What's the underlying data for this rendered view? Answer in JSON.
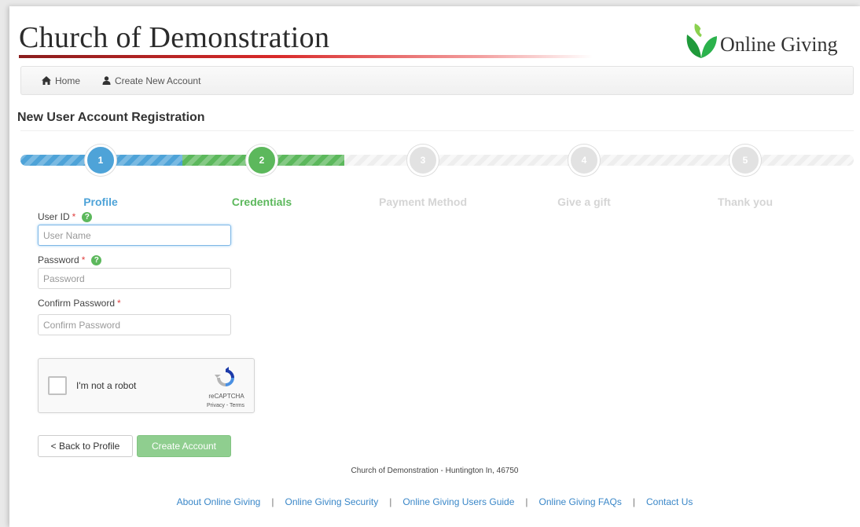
{
  "header": {
    "church_name": "Church of Demonstration",
    "logo_text": "Online Giving",
    "accent_color": "#d92a2a"
  },
  "nav": {
    "items": [
      {
        "label": "Home",
        "icon": "home-icon"
      },
      {
        "label": "Create New Account",
        "icon": "user-icon"
      }
    ]
  },
  "page": {
    "heading": "New User Account Registration"
  },
  "stepper": {
    "steps": [
      {
        "number": "1",
        "label": "Profile",
        "state": "complete",
        "color": "#4ea3d8"
      },
      {
        "number": "2",
        "label": "Credentials",
        "state": "active",
        "color": "#5cb85c"
      },
      {
        "number": "3",
        "label": "Payment Method",
        "state": "pending",
        "color": "#e2e2e2"
      },
      {
        "number": "4",
        "label": "Give a gift",
        "state": "pending",
        "color": "#e2e2e2"
      },
      {
        "number": "5",
        "label": "Thank you",
        "state": "pending",
        "color": "#e2e2e2"
      }
    ]
  },
  "form": {
    "user_id": {
      "label": "User ID",
      "required": "*",
      "placeholder": "User Name",
      "value": ""
    },
    "password": {
      "label": "Password",
      "required": "*",
      "placeholder": "Password",
      "value": ""
    },
    "confirm_password": {
      "label": "Confirm Password",
      "required": "*",
      "placeholder": "Confirm Password",
      "value": ""
    },
    "help_glyph": "?"
  },
  "captcha": {
    "label": "I'm not a robot",
    "brand": "reCAPTCHA",
    "terms": "Privacy - Terms"
  },
  "buttons": {
    "back": "< Back to Profile",
    "create": "Create Account"
  },
  "footer": {
    "address": "Church of Demonstration - Huntington In, 46750",
    "separator": "|",
    "links": [
      "About Online Giving",
      "Online Giving Security",
      "Online Giving Users Guide",
      "Online Giving FAQs",
      "Contact Us"
    ]
  }
}
